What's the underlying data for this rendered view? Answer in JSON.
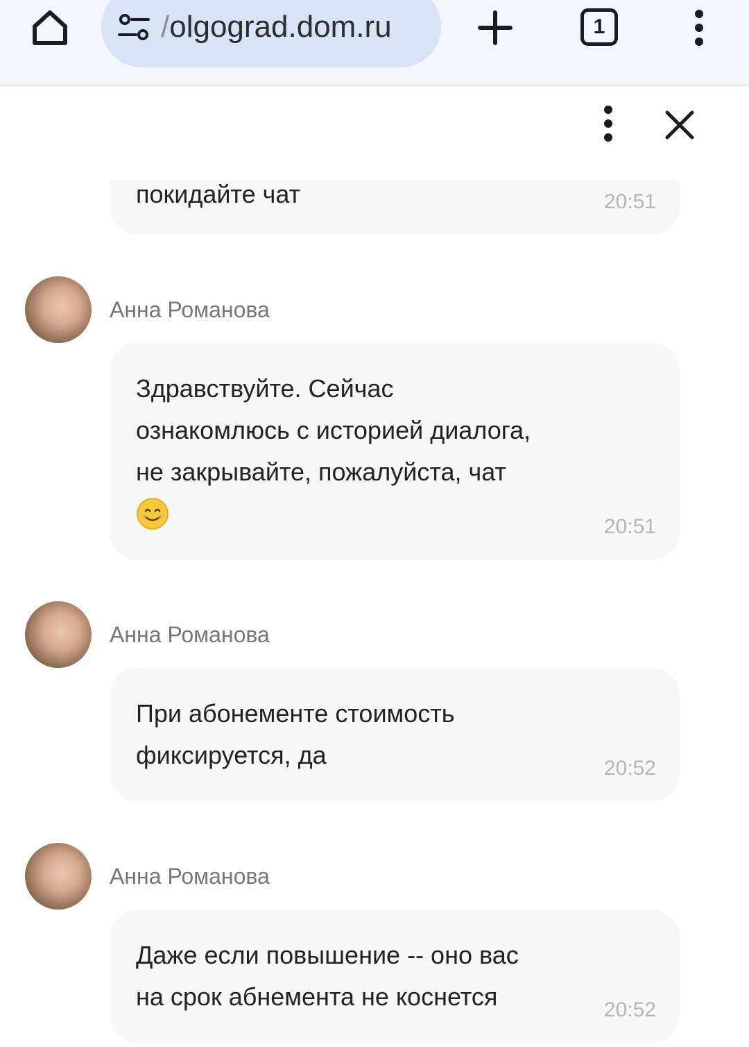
{
  "browser": {
    "url": "olgograd.dom.ru",
    "url_prefix": "/",
    "tab_count": "1"
  },
  "chat": {
    "messages": [
      {
        "sender": "",
        "text": "покидайте чат",
        "time": "20:51"
      },
      {
        "sender": "Анна Романова",
        "text": "Здравствуйте. Сейчас\nознакомлюсь с историей диалога,\nне закрывайте, пожалуйста, чат",
        "time": "20:51",
        "emoji": "smiling-face-emoji"
      },
      {
        "sender": "Анна Романова",
        "text": "При абонементе стоимость\nфиксируется, да",
        "time": "20:52"
      },
      {
        "sender": "Анна Романова",
        "text": "Даже если повышение -- оно вас\nна срок абнемента не коснется",
        "time": "20:52"
      }
    ]
  },
  "colors": {
    "toolbar_bg": "#f3f6fc",
    "url_pill_bg": "#d9e3f7",
    "bubble_bg": "#f7f7f7",
    "time_text": "#b5b5b5",
    "sender_text": "#767676"
  }
}
